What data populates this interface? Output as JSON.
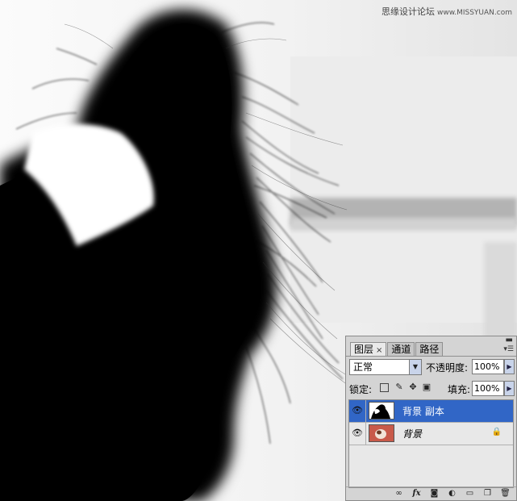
{
  "watermark": {
    "text": "思缘设计论坛",
    "site": "www.MISSYUAN.com"
  },
  "panel": {
    "tabs": [
      {
        "label": "图层",
        "active": true
      },
      {
        "label": "通道",
        "active": false
      },
      {
        "label": "路径",
        "active": false
      }
    ],
    "close_glyph": "×",
    "blend_mode": {
      "value": "正常"
    },
    "opacity": {
      "label": "不透明度:",
      "value": "100%"
    },
    "lock": {
      "label": "锁定:"
    },
    "fill": {
      "label": "填充:",
      "value": "100%"
    },
    "layers": [
      {
        "name": "背景 副本",
        "selected": true,
        "visible_icon": "eye-icon"
      },
      {
        "name": "背景",
        "selected": false,
        "locked": true,
        "visible_icon": "eye-icon"
      }
    ],
    "footer_icons": [
      "link-icon",
      "fx-icon",
      "mask-icon",
      "adjustment-icon",
      "folder-icon",
      "new-layer-icon",
      "trash-icon"
    ],
    "fx_label": "fx",
    "colors": {
      "selection": "#3166c6",
      "panel_bg": "#d4d4d4"
    }
  }
}
